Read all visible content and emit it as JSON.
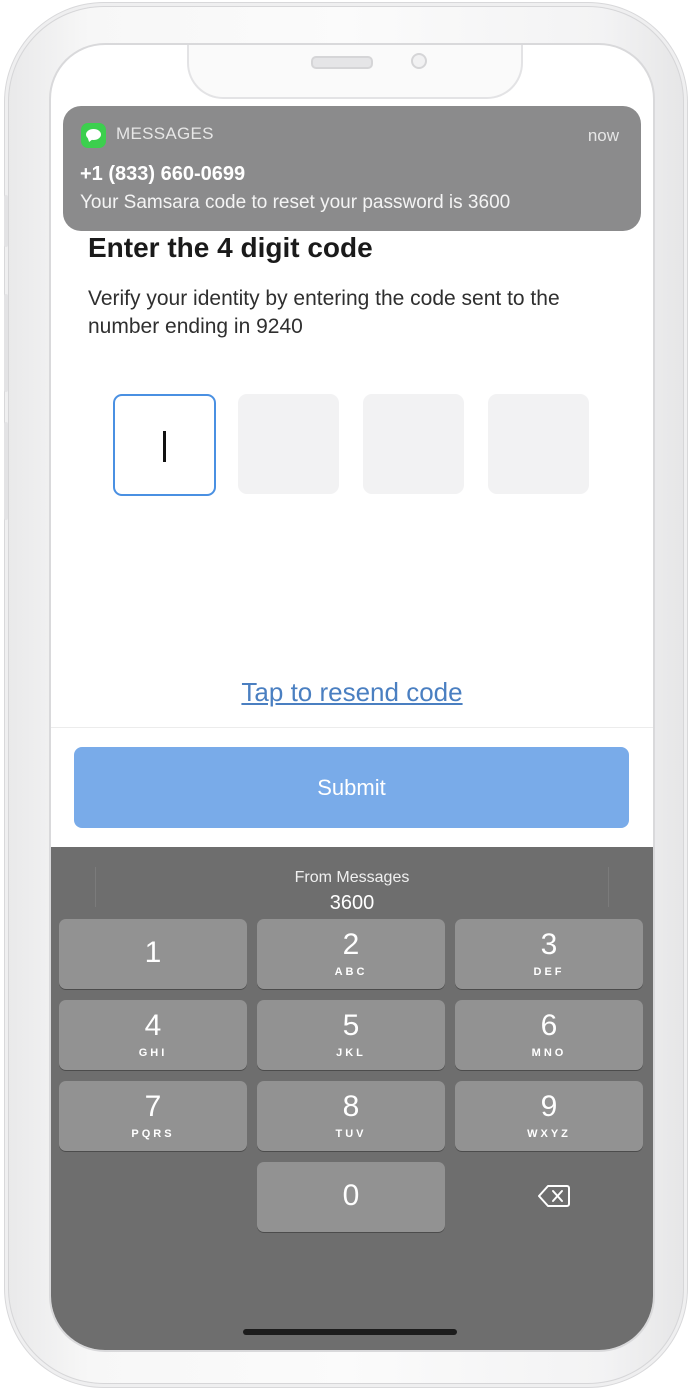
{
  "notification": {
    "app_icon": "messages-app-icon",
    "app": "MESSAGES",
    "time": "now",
    "sender": "+1 (833) 660-0699",
    "body": "Your Samsara code to reset your password is 3600"
  },
  "page": {
    "title": "Enter the 4 digit code",
    "subtitle": "Verify your identity by entering the code sent to the number ending in 9240"
  },
  "code_inputs": [
    "",
    "",
    "",
    ""
  ],
  "resend_label": "Tap to resend code",
  "submit_label": "Submit",
  "keyboard": {
    "suggestion_source": "From Messages",
    "suggestion_code": "3600",
    "keys": [
      {
        "num": "1",
        "letters": ""
      },
      {
        "num": "2",
        "letters": "ABC"
      },
      {
        "num": "3",
        "letters": "DEF"
      },
      {
        "num": "4",
        "letters": "GHI"
      },
      {
        "num": "5",
        "letters": "JKL"
      },
      {
        "num": "6",
        "letters": "MNO"
      },
      {
        "num": "7",
        "letters": "PQRS"
      },
      {
        "num": "8",
        "letters": "TUV"
      },
      {
        "num": "9",
        "letters": "WXYZ"
      },
      {
        "num": "0",
        "letters": ""
      }
    ],
    "delete_icon": "backspace-icon"
  },
  "colors": {
    "accent": "#4a90e2",
    "submit_bg": "#79abe9",
    "link": "#4a7fc1",
    "keyboard_bg": "#6e6e6e",
    "key_bg": "#929292",
    "notification_bg": "#8b8b8c"
  }
}
